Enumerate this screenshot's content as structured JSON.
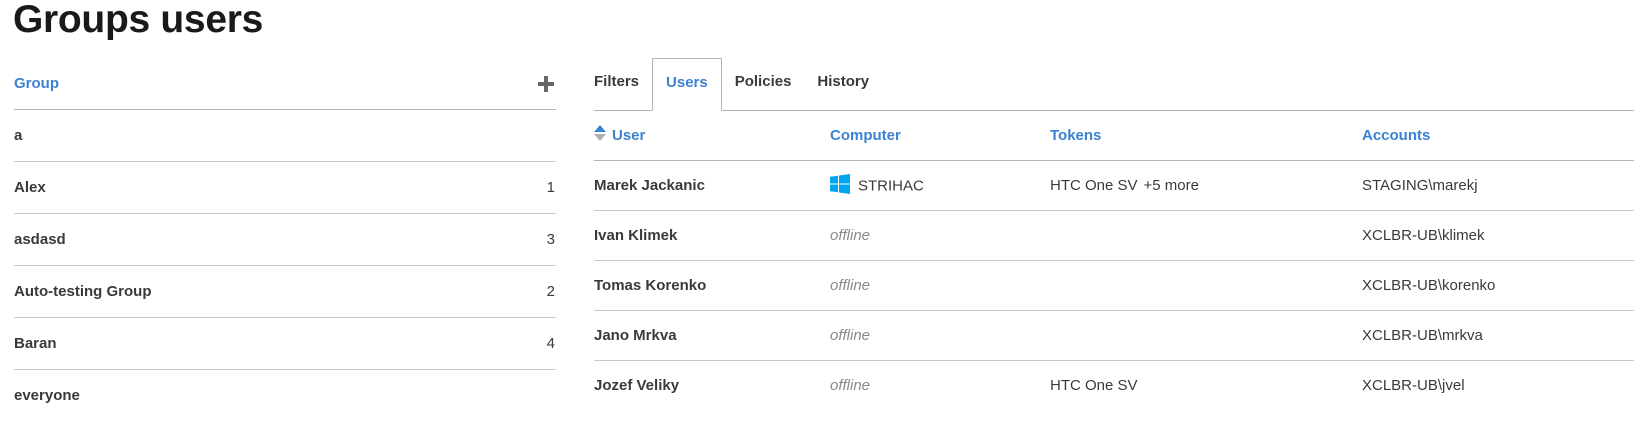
{
  "page": {
    "title": "Groups users"
  },
  "groups": {
    "header": "Group",
    "add_icon": "plus-icon",
    "items": [
      {
        "name": "a",
        "count": ""
      },
      {
        "name": "Alex",
        "count": "1"
      },
      {
        "name": "asdasd",
        "count": "3"
      },
      {
        "name": "Auto-testing Group",
        "count": "2"
      },
      {
        "name": "Baran",
        "count": "4"
      },
      {
        "name": "everyone",
        "count": ""
      }
    ]
  },
  "tabs": {
    "items": [
      {
        "label": "Filters",
        "active": false
      },
      {
        "label": "Users",
        "active": true
      },
      {
        "label": "Policies",
        "active": false
      },
      {
        "label": "History",
        "active": false
      }
    ]
  },
  "users": {
    "columns": {
      "user": "User",
      "computer": "Computer",
      "tokens": "Tokens",
      "accounts": "Accounts"
    },
    "sort_icon": "sort-arrows-icon",
    "rows": [
      {
        "user": "Marek Jackanic",
        "computer": "STRIHAC",
        "computer_icon": "windows-icon",
        "tokens": "HTC One SV",
        "tokens_more": "+5 more",
        "account": "STAGING\\marekj"
      },
      {
        "user": "Ivan Klimek",
        "computer": "offline",
        "tokens": "",
        "tokens_more": "",
        "account": "XCLBR-UB\\klimek"
      },
      {
        "user": "Tomas Korenko",
        "computer": "offline",
        "tokens": "",
        "tokens_more": "",
        "account": "XCLBR-UB\\korenko"
      },
      {
        "user": "Jano Mrkva",
        "computer": "offline",
        "tokens": "",
        "tokens_more": "",
        "account": "XCLBR-UB\\mrkva"
      },
      {
        "user": "Jozef Veliky",
        "computer": "offline",
        "tokens": "HTC One SV",
        "tokens_more": "",
        "account": "XCLBR-UB\\jvel"
      }
    ]
  },
  "colors": {
    "accent": "#3b82d0",
    "windows": "#00a4ef",
    "offline": "#8a8a8a"
  }
}
